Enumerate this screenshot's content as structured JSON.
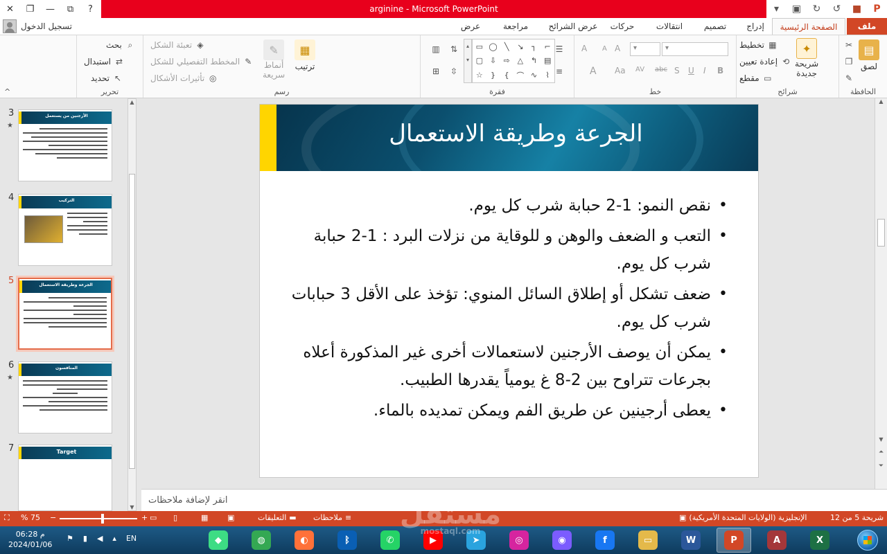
{
  "window": {
    "title": "arginine -  Microsoft PowerPoint",
    "help_label": "?",
    "minimize_label": "—",
    "restore_label": "❐",
    "close_label": "✕"
  },
  "quick_access": {
    "save_icon": "save-icon",
    "undo_icon": "undo-icon",
    "redo_icon": "redo-icon",
    "start_icon": "slideshow-icon"
  },
  "signin_label": "تسجيل الدخول",
  "tabs": [
    {
      "label": "ملف"
    },
    {
      "label": "الصفحة الرئيسية"
    },
    {
      "label": "إدراج"
    },
    {
      "label": "تصميم"
    },
    {
      "label": "انتقالات"
    },
    {
      "label": "حركات"
    },
    {
      "label": "عرض الشرائح"
    },
    {
      "label": "مراجعة"
    },
    {
      "label": "عرض"
    }
  ],
  "ribbon": {
    "clipboard": {
      "label": "الحافظة",
      "paste": "لصق"
    },
    "slides": {
      "label": "شرائح",
      "new_slide_line1": "شريحة",
      "new_slide_line2": "جديدة",
      "layout": "تخطيط",
      "reset": "إعادة تعيين",
      "section": "مقطع"
    },
    "font": {
      "label": "خط",
      "bold": "B",
      "italic": "I",
      "underline": "U",
      "shadow": "S",
      "strike": "abc",
      "grow": "A",
      "shrink": "A",
      "clear": "A",
      "spacing": "AV",
      "case": "Aa",
      "color": "A"
    },
    "paragraph": {
      "label": "فقرة"
    },
    "drawing": {
      "label": "رسم",
      "arrange": "ترتيب",
      "quick_styles_line1": "أنماط",
      "quick_styles_line2": "سريعة",
      "shape_fill": "تعبئة الشكل",
      "shape_outline": "المخطط التفصيلي للشكل",
      "shape_effects": "تأثيرات الأشكال"
    },
    "editing": {
      "label": "تحرير",
      "find": "بحث",
      "replace": "استبدال",
      "select": "تحديد"
    }
  },
  "thumbnails": [
    {
      "num": "3",
      "title": "الأرجنين من يستعمل"
    },
    {
      "num": "4",
      "title": "التركيب"
    },
    {
      "num": "5",
      "title": "الجرعة وطريقة الاستعمال"
    },
    {
      "num": "6",
      "title": "المنافسون"
    },
    {
      "num": "7",
      "title": "Target"
    }
  ],
  "slide": {
    "title": "الجرعة وطريقة الاستعمال",
    "bullets": [
      "نقص النمو: 1-2 حبابة شرب كل يوم.",
      "التعب و الضعف والوهن و للوقاية من نزلات البرد : 1-2 حبابة شرب كل يوم.",
      "ضعف تشكل أو إطلاق السائل المنوي: تؤخذ على الأقل 3 حبابات شرب كل يوم.",
      "يمكن أن يوصف الأرجنين لاستعمالات أخرى غير المذكورة أعلاه بجرعات تتراوح بين 2-8 غ يومياً يقدرها الطبيب.",
      "يعطى أرجينين عن طريق الفم ويمكن تمديده بالماء."
    ]
  },
  "notes_placeholder": "انقر لإضافة ملاحظات",
  "statusbar": {
    "slide_counter": "شريحة 5 من 12",
    "language": "الإنجليزية (الولايات المتحدة الأمريكية)",
    "notes": "ملاحظات",
    "comments": "التعليقات",
    "zoom": "75 %",
    "zoom_minus": "−",
    "zoom_plus": "+",
    "zoom_level": 0.55
  },
  "taskbar": {
    "time": "06:28 م",
    "date": "2024/01/06",
    "lang": "EN",
    "apps": [
      {
        "name": "excel-app",
        "label": "X",
        "color": "#1d7044"
      },
      {
        "name": "access-app",
        "label": "A",
        "color": "#a4373a"
      },
      {
        "name": "powerpoint-app",
        "label": "P",
        "color": "#d24726"
      },
      {
        "name": "word-app",
        "label": "W",
        "color": "#2b579a"
      },
      {
        "name": "explorer-app",
        "label": "▭",
        "color": "#e4b94a"
      },
      {
        "name": "facebook-app",
        "label": "f",
        "color": "#1877f2"
      },
      {
        "name": "messenger-app",
        "label": "◉",
        "color": "#7b5cff"
      },
      {
        "name": "instagram-app",
        "label": "◎",
        "color": "#d6249f"
      },
      {
        "name": "telegram-app",
        "label": "➤",
        "color": "#2aa3de"
      },
      {
        "name": "youtube-app",
        "label": "▶",
        "color": "#ff0000"
      },
      {
        "name": "whatsapp-app",
        "label": "✆",
        "color": "#25d366"
      },
      {
        "name": "bluetooth-app",
        "label": "ᛒ",
        "color": "#0a5fb4"
      },
      {
        "name": "firefox-app",
        "label": "◐",
        "color": "#ff7139"
      },
      {
        "name": "chrome-app",
        "label": "◍",
        "color": "#34a853"
      },
      {
        "name": "android-app",
        "label": "◆",
        "color": "#3ddc84"
      }
    ]
  },
  "watermark": {
    "text": "مستقل",
    "sub": "mostaql.com"
  },
  "colors": {
    "accent": "#d24726",
    "title_red": "#e8001c",
    "slide_blue": "#0b4f6e",
    "slide_yellow": "#ffd500"
  }
}
